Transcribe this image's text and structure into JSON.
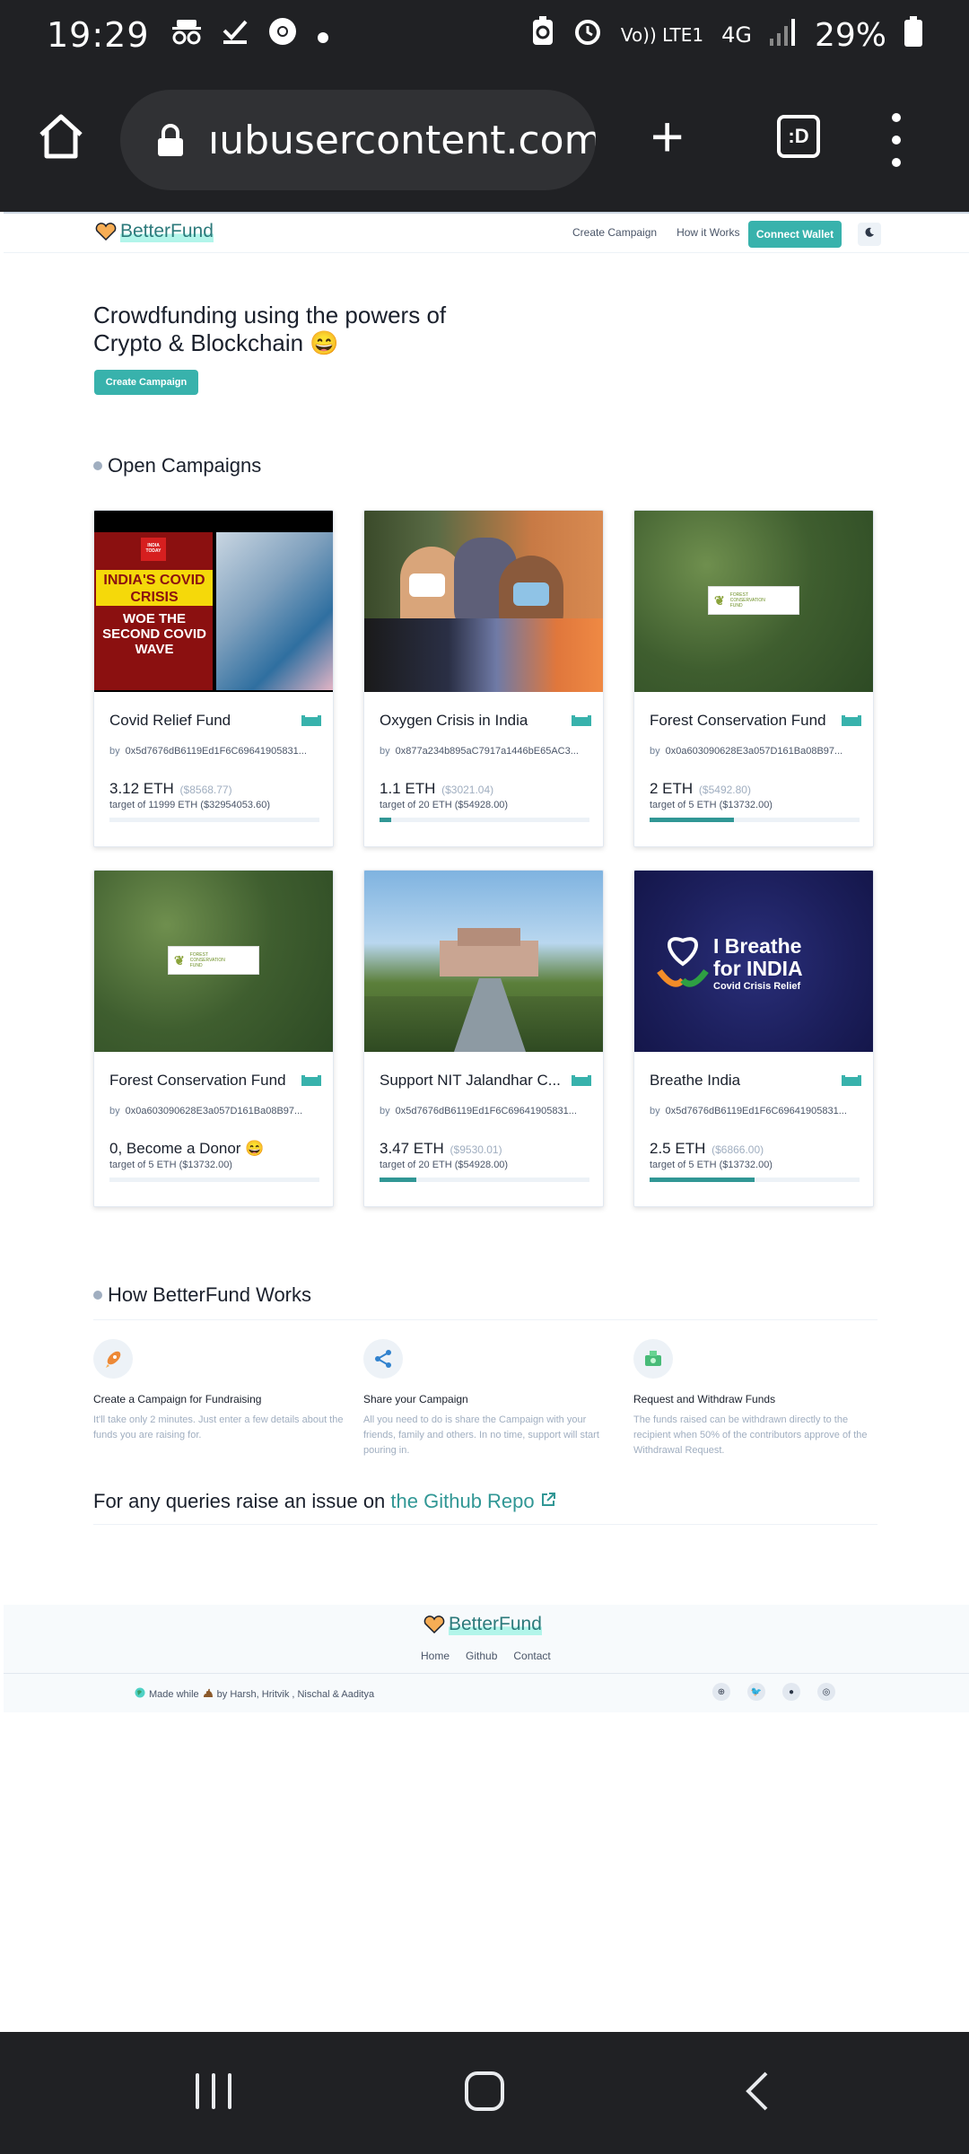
{
  "status_bar": {
    "time": "19:29",
    "network_type": "4G",
    "volte": "Vo)) LTE1",
    "battery": "29%",
    "icons": [
      "incognito-icon",
      "checkmark-icon",
      "chrome-icon",
      "dot-icon",
      "battery-saver-icon",
      "alarm-icon",
      "signal-icon",
      "battery-icon"
    ]
  },
  "browser": {
    "url": "ıubusercontent.com",
    "tab_switcher_label": ":D"
  },
  "site": {
    "logo_text": "BetterFund",
    "nav": {
      "create_campaign": "Create Campaign",
      "how_it_works": "How it Works",
      "connect_wallet": "Connect Wallet"
    },
    "hero": {
      "title": "Crowdfunding using the powers of Crypto & Blockchain 😄",
      "button": "Create Campaign"
    },
    "open_campaigns_title": "Open Campaigns",
    "campaigns": [
      {
        "title": "Covid Relief Fund",
        "by_label": "by",
        "address": "0x5d7676dB6119Ed1F6C69641905831...",
        "amount": "3.12 ETH",
        "usd": "($8568.77)",
        "target": "target of 11999 ETH ($32954053.60)",
        "progress": 0.0003,
        "image": {
          "news_badge": "INDIA TODAY",
          "headline": "INDIA'S COVID CRISIS",
          "sub": "WOE THE SECOND COVID WAVE"
        }
      },
      {
        "title": "Oxygen Crisis in India",
        "by_label": "by",
        "address": "0x877a234b895aC7917a1446bE65AC3...",
        "amount": "1.1 ETH",
        "usd": "($3021.04)",
        "target": "target of 20 ETH ($54928.00)",
        "progress": 0.055,
        "image": {}
      },
      {
        "title": "Forest Conservation Fund",
        "by_label": "by",
        "address": "0x0a603090628E3a057D161Ba08B97...",
        "amount": "2 ETH",
        "usd": "($5492.80)",
        "target": "target of 5 ETH ($13732.00)",
        "progress": 0.4,
        "image": {
          "sign": "FOREST CONSERVATION FUND"
        }
      },
      {
        "title": "Forest Conservation Fund",
        "by_label": "by",
        "address": "0x0a603090628E3a057D161Ba08B97...",
        "amount": "0, Become a Donor 😄",
        "usd": "",
        "target": "target of 5 ETH ($13732.00)",
        "progress": 0,
        "image": {
          "sign": "FOREST CONSERVATION FUND"
        }
      },
      {
        "title": "Support NIT Jalandhar C...",
        "by_label": "by",
        "address": "0x5d7676dB6119Ed1F6C69641905831...",
        "amount": "3.47 ETH",
        "usd": "($9530.01)",
        "target": "target of 20 ETH ($54928.00)",
        "progress": 0.1735,
        "image": {}
      },
      {
        "title": "Breathe India",
        "by_label": "by",
        "address": "0x5d7676dB6119Ed1F6C69641905831...",
        "amount": "2.5 ETH",
        "usd": "($6866.00)",
        "target": "target of 5 ETH ($13732.00)",
        "progress": 0.5,
        "image": {
          "line1": "I Breathe",
          "line2": "for INDIA",
          "line3": "Covid Crisis Relief"
        }
      }
    ],
    "how_title": "How BetterFund Works",
    "steps": [
      {
        "title": "Create a Campaign for Fundraising",
        "desc": "It'll take only 2 minutes. Just enter a few details about the funds you are raising for.",
        "icon": "rocket-icon"
      },
      {
        "title": "Share your Campaign",
        "desc": "All you need to do is share the Campaign with your friends, family and others. In no time, support will start pouring in.",
        "icon": "share-icon"
      },
      {
        "title": "Request and Withdraw Funds",
        "desc": "The funds raised can be withdrawn directly to the recipient when 50% of the contributors approve of the Withdrawal Request.",
        "icon": "money-icon"
      }
    ],
    "query_prefix": "For any queries raise an issue on",
    "query_link": "the Github Repo",
    "footer": {
      "logo_text": "BetterFund",
      "links": [
        "Home",
        "Github",
        "Contact"
      ],
      "made_prefix": "Made while",
      "made_suffix": "by Harsh, Hritvik , Nischal & Aaditya",
      "socials": [
        "globe-icon",
        "twitter-icon",
        "github-icon",
        "instagram-icon"
      ]
    }
  },
  "colors": {
    "accent": "#38b2ac",
    "accent_dark": "#319795",
    "chrome_bg": "#202124"
  }
}
